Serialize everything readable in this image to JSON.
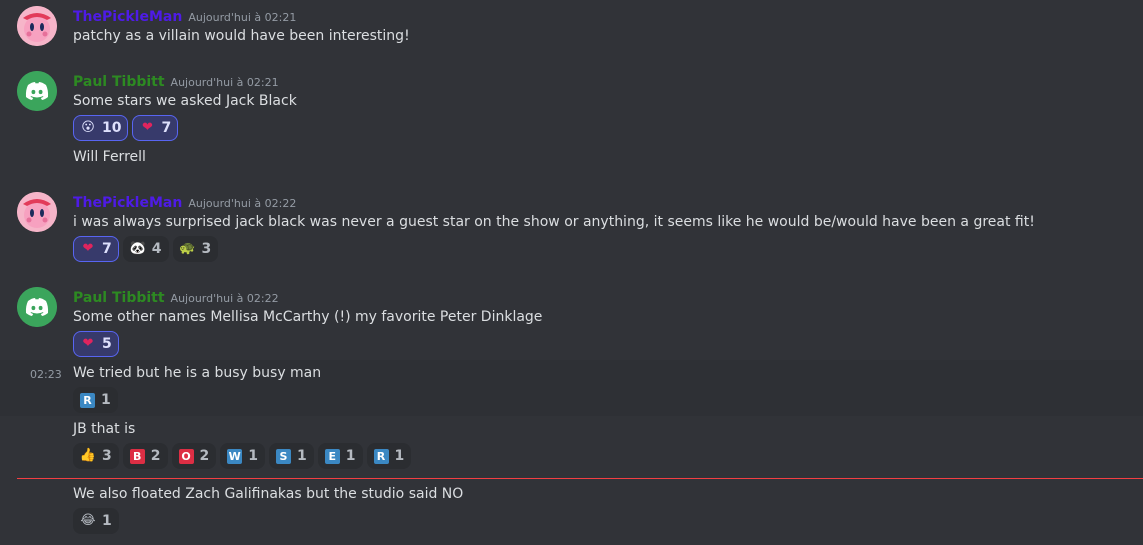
{
  "messages": [
    {
      "author": "ThePickleMan",
      "timestamp": "Aujourd'hui à 02:21",
      "text": "patchy as a villain would have been interesting!"
    },
    {
      "author": "Paul Tibbitt",
      "timestamp": "Aujourd'hui à 02:21",
      "text": "Some stars we asked Jack Black",
      "reactions": [
        {
          "emoji": "😮",
          "count": "10",
          "me": true
        },
        {
          "emoji": "❤",
          "count": "7",
          "me": true
        }
      ],
      "followup": "Will Ferrell"
    },
    {
      "author": "ThePickleMan",
      "timestamp": "Aujourd'hui à 02:22",
      "text": "i was always surprised jack black was never a guest star on the show or anything, it seems like he would be/would have been a great fit!",
      "reactions": [
        {
          "emoji": "❤",
          "count": "7",
          "me": true
        },
        {
          "emoji": "🐼",
          "count": "4",
          "me": false
        },
        {
          "emoji": "🐢",
          "count": "3",
          "me": false
        }
      ]
    },
    {
      "author": "Paul Tibbitt",
      "timestamp": "Aujourd'hui à 02:22",
      "text": "Some other names Mellisa McCarthy (!) my favorite Peter Dinklage",
      "reactions": [
        {
          "emoji": "❤",
          "count": "5",
          "me": true
        }
      ]
    }
  ],
  "continuations": [
    {
      "side_time": "02:23",
      "text": "We tried but he is a busy busy man",
      "reactions": [
        {
          "letter": "R",
          "color": "#3b88c3",
          "count": "1"
        }
      ]
    },
    {
      "text": "JB that is",
      "reactions": [
        {
          "emoji": "👍",
          "count": "3"
        },
        {
          "letter": "B",
          "color": "#dd2e44",
          "count": "2"
        },
        {
          "letter": "O",
          "color": "#dd2e44",
          "count": "2"
        },
        {
          "letter": "W",
          "color": "#3b88c3",
          "count": "1"
        },
        {
          "letter": "S",
          "color": "#3b88c3",
          "count": "1"
        },
        {
          "letter": "E",
          "color": "#3b88c3",
          "count": "1"
        },
        {
          "letter": "R",
          "color": "#3b88c3",
          "count": "1"
        }
      ]
    },
    {
      "text": "We also floated Zach Galifinakas but the studio said NO",
      "reactions": [
        {
          "emoji": "😂",
          "count": "1"
        }
      ]
    }
  ]
}
